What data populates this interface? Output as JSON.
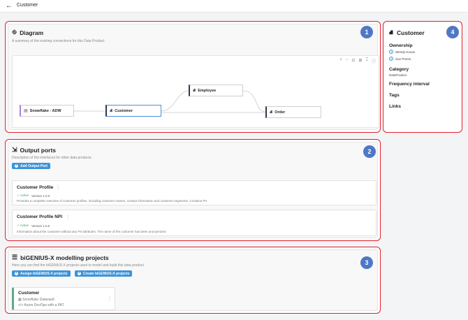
{
  "header": {
    "back_icon": "←",
    "title": "Customer"
  },
  "badges": [
    "1",
    "2",
    "3",
    "4"
  ],
  "diagram": {
    "icon": "diagram-icon",
    "title": "Diagram",
    "description": "A summary of the existing connections for this Data Product.",
    "tools": [
      "+",
      "−",
      "⊡",
      "⊠",
      "⌶",
      "ⓘ"
    ],
    "nodes": {
      "snowflake": "Snowflake - ADW",
      "customer": "Customer",
      "employee": "Employee",
      "order": "Order"
    }
  },
  "output_ports": {
    "icon": "output-port-icon",
    "title": "Output ports",
    "description": "Description of the interfaces for other data products.",
    "add_button": "Add Output Port",
    "ports": [
      {
        "name": "Customer Profile",
        "status": "✓ Active",
        "version": "Version 1.0.0",
        "description": "Provides a complete overview of customer profiles, including customer names, contact information and customer segments. Contains PII"
      },
      {
        "name": "Customer Profile NPI",
        "status": "✓ Active",
        "version": "Version 1.0.0",
        "description": "Information about the customer without any PII attributes. The name of the customer has been anonymized"
      }
    ]
  },
  "projects": {
    "icon": "list-icon",
    "title": "biGENIUS-X modelling projects",
    "description": "Here you can find the biGENIUS-X projects used to model and build this data product.",
    "assign_button": "Assign biGENIUS-X projects",
    "create_button": "Create biGENIUS-X projects",
    "items": [
      {
        "name": "Customer",
        "line1": "Snowflake Datavault",
        "line2": "Azure DevOps with a PAT"
      }
    ]
  },
  "side": {
    "title": "Customer",
    "ownership_label": "Ownership",
    "owners": [
      "Wendy House",
      "Sue Preem"
    ],
    "category_label": "Category",
    "category_value": "DataProduct",
    "frequency_label": "Frequency interval",
    "tags_label": "Tags",
    "links_label": "Links"
  },
  "colors": {
    "highlight": "#e2202a",
    "badge": "#4f78c4",
    "button": "#3d93d8",
    "active": "#3a9d5d"
  }
}
